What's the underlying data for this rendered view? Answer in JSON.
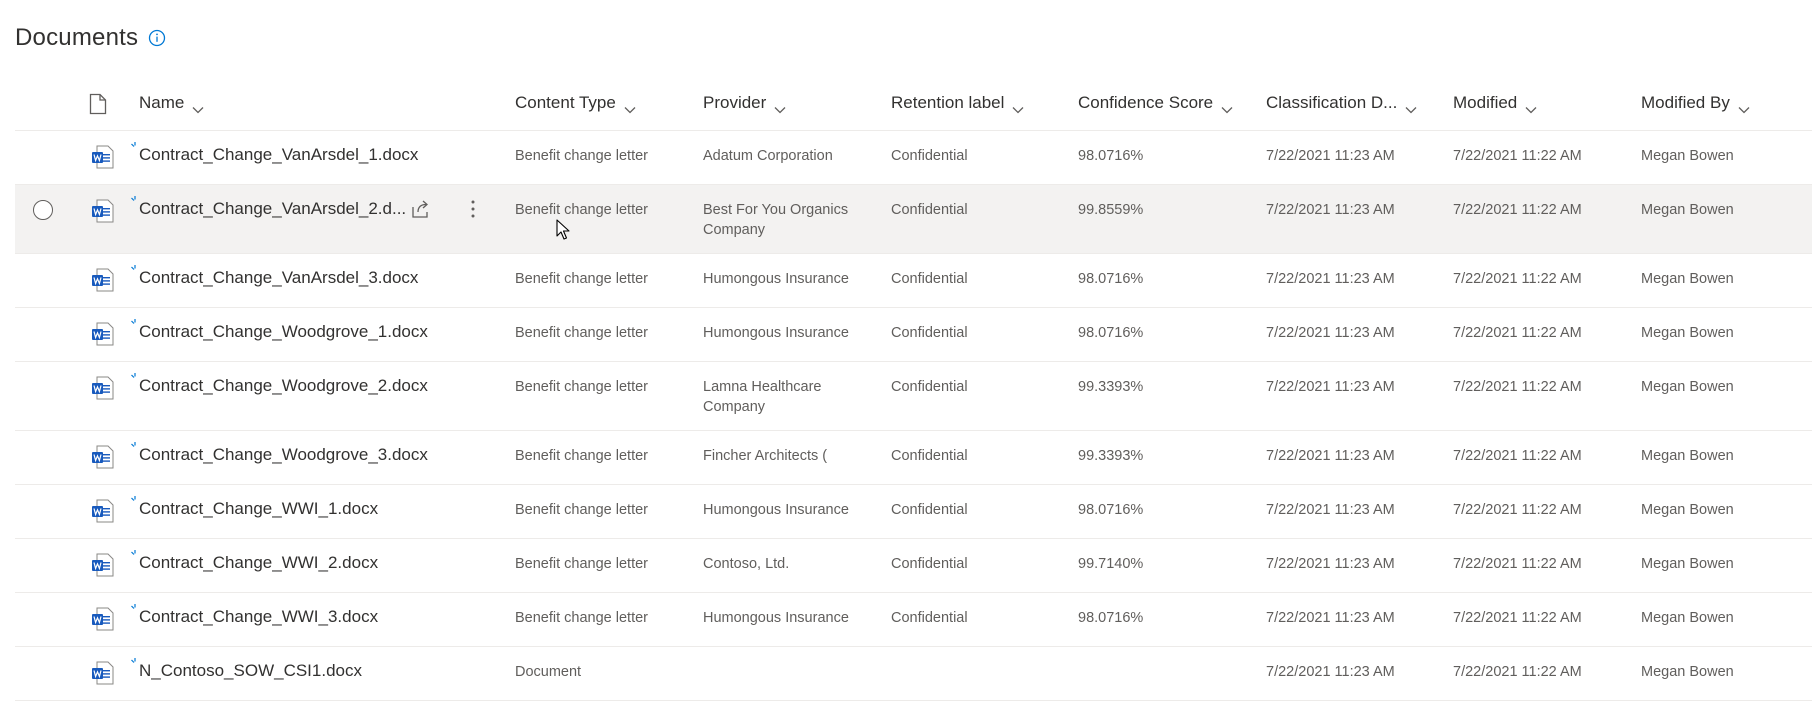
{
  "page": {
    "title": "Documents",
    "info_icon": "info-icon"
  },
  "columns": {
    "name": "Name",
    "content_type": "Content Type",
    "provider": "Provider",
    "retention_label": "Retention label",
    "confidence_score": "Confidence Score",
    "classification_date": "Classification D...",
    "modified": "Modified",
    "modified_by": "Modified By"
  },
  "rows": [
    {
      "name": "Contract_Change_VanArsdel_1.docx",
      "content_type": "Benefit change letter",
      "provider": "Adatum Corporation",
      "retention_label": "Confidential",
      "confidence_score": "98.0716%",
      "classification_date": "7/22/2021 11:23 AM",
      "modified": "7/22/2021 11:22 AM",
      "modified_by": "Megan Bowen"
    },
    {
      "name": "Contract_Change_VanArsdel_2.d...",
      "content_type": "Benefit change letter",
      "provider": "Best For You Organics Company",
      "retention_label": "Confidential",
      "confidence_score": "99.8559%",
      "classification_date": "7/22/2021 11:23 AM",
      "modified": "7/22/2021 11:22 AM",
      "modified_by": "Megan Bowen"
    },
    {
      "name": "Contract_Change_VanArsdel_3.docx",
      "content_type": "Benefit change letter",
      "provider": "Humongous Insurance",
      "retention_label": "Confidential",
      "confidence_score": "98.0716%",
      "classification_date": "7/22/2021 11:23 AM",
      "modified": "7/22/2021 11:22 AM",
      "modified_by": "Megan Bowen"
    },
    {
      "name": "Contract_Change_Woodgrove_1.docx",
      "content_type": "Benefit change letter",
      "provider": "Humongous Insurance",
      "retention_label": "Confidential",
      "confidence_score": "98.0716%",
      "classification_date": "7/22/2021 11:23 AM",
      "modified": "7/22/2021 11:22 AM",
      "modified_by": "Megan Bowen"
    },
    {
      "name": "Contract_Change_Woodgrove_2.docx",
      "content_type": "Benefit change letter",
      "provider": "Lamna Healthcare Company",
      "retention_label": "Confidential",
      "confidence_score": "99.3393%",
      "classification_date": "7/22/2021 11:23 AM",
      "modified": "7/22/2021 11:22 AM",
      "modified_by": "Megan Bowen"
    },
    {
      "name": "Contract_Change_Woodgrove_3.docx",
      "content_type": "Benefit change letter",
      "provider": "Fincher Architects (",
      "retention_label": "Confidential",
      "confidence_score": "99.3393%",
      "classification_date": "7/22/2021 11:23 AM",
      "modified": "7/22/2021 11:22 AM",
      "modified_by": "Megan Bowen"
    },
    {
      "name": "Contract_Change_WWI_1.docx",
      "content_type": "Benefit change letter",
      "provider": "Humongous Insurance",
      "retention_label": "Confidential",
      "confidence_score": "98.0716%",
      "classification_date": "7/22/2021 11:23 AM",
      "modified": "7/22/2021 11:22 AM",
      "modified_by": "Megan Bowen"
    },
    {
      "name": "Contract_Change_WWI_2.docx",
      "content_type": "Benefit change letter",
      "provider": "Contoso, Ltd.",
      "retention_label": "Confidential",
      "confidence_score": "99.7140%",
      "classification_date": "7/22/2021 11:23 AM",
      "modified": "7/22/2021 11:22 AM",
      "modified_by": "Megan Bowen"
    },
    {
      "name": "Contract_Change_WWI_3.docx",
      "content_type": "Benefit change letter",
      "provider": "Humongous Insurance",
      "retention_label": "Confidential",
      "confidence_score": "98.0716%",
      "classification_date": "7/22/2021 11:23 AM",
      "modified": "7/22/2021 11:22 AM",
      "modified_by": "Megan Bowen"
    },
    {
      "name": "N_Contoso_SOW_CSI1.docx",
      "content_type": "Document",
      "provider": "",
      "retention_label": "",
      "confidence_score": "",
      "classification_date": "7/22/2021 11:23 AM",
      "modified": "7/22/2021 11:22 AM",
      "modified_by": "Megan Bowen"
    }
  ],
  "colors": {
    "accent": "#0078d4",
    "word_blue": "#185abd",
    "row_hover": "#f3f2f1",
    "text_primary": "#323130",
    "text_secondary": "#605e5c"
  }
}
